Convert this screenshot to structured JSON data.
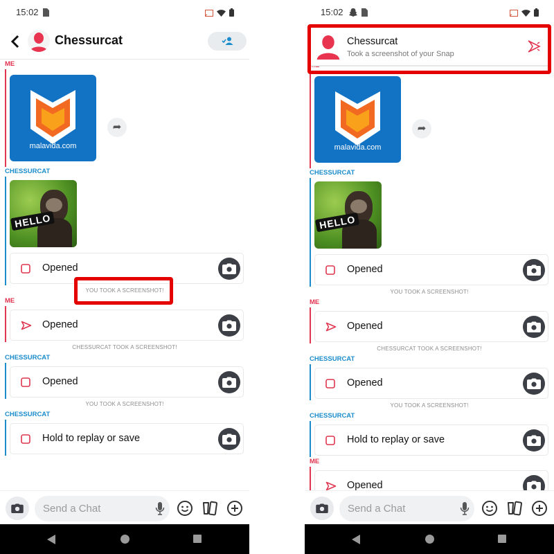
{
  "colors": {
    "me": "#e0344f",
    "them": "#1a8ccb",
    "highlight": "#e50000",
    "camera_button": "#3c3f45"
  },
  "status_bar": {
    "time": "15:02"
  },
  "left_panel": {
    "header": {
      "title": "Chessurcat",
      "back_icon": "chevron-left-icon",
      "add_friend_icon": "add-friend-icon"
    },
    "messages": [
      {
        "type": "label",
        "sender": "me",
        "text": "ME"
      },
      {
        "type": "group",
        "sender": "me",
        "first": true,
        "items": [
          {
            "kind": "image",
            "image": "malavida",
            "caption": "malavida.com"
          }
        ]
      },
      {
        "type": "label",
        "sender": "them",
        "text": "CHESSURCAT"
      },
      {
        "type": "group",
        "sender": "them",
        "items": [
          {
            "kind": "image",
            "image": "monkey",
            "caption": "HELLO"
          },
          {
            "kind": "snap",
            "icon": "square",
            "text": "Opened"
          }
        ]
      },
      {
        "type": "notice",
        "text": "YOU TOOK A SCREENSHOT!",
        "highlighted": true
      },
      {
        "type": "label",
        "sender": "me",
        "text": "ME"
      },
      {
        "type": "group",
        "sender": "me",
        "items": [
          {
            "kind": "snap",
            "icon": "arrow",
            "text": "Opened"
          }
        ]
      },
      {
        "type": "notice",
        "text": "CHESSURCAT TOOK A SCREENSHOT!"
      },
      {
        "type": "label",
        "sender": "them",
        "text": "CHESSURCAT"
      },
      {
        "type": "group",
        "sender": "them",
        "items": [
          {
            "kind": "snap",
            "icon": "square",
            "text": "Opened"
          }
        ]
      },
      {
        "type": "notice",
        "text": "YOU TOOK A SCREENSHOT!"
      },
      {
        "type": "label",
        "sender": "them",
        "text": "CHESSURCAT"
      },
      {
        "type": "group",
        "sender": "them",
        "items": [
          {
            "kind": "snap",
            "icon": "square",
            "text": "Hold to replay or save"
          }
        ]
      }
    ]
  },
  "right_panel": {
    "notification": {
      "title": "Chessurcat",
      "subtitle": "Took a screenshot of your Snap",
      "icon": "screenshot-arrow-icon",
      "highlighted": true
    },
    "messages": [
      {
        "type": "label",
        "sender": "me",
        "text": "ME"
      },
      {
        "type": "group",
        "sender": "me",
        "first": true,
        "items": [
          {
            "kind": "image",
            "image": "malavida",
            "caption": "malavida.com"
          }
        ]
      },
      {
        "type": "label",
        "sender": "them",
        "text": "CHESSURCAT"
      },
      {
        "type": "group",
        "sender": "them",
        "items": [
          {
            "kind": "image",
            "image": "monkey",
            "caption": "HELLO"
          },
          {
            "kind": "snap",
            "icon": "square",
            "text": "Opened"
          }
        ]
      },
      {
        "type": "notice",
        "text": "YOU TOOK A SCREENSHOT!"
      },
      {
        "type": "label",
        "sender": "me",
        "text": "ME"
      },
      {
        "type": "group",
        "sender": "me",
        "items": [
          {
            "kind": "snap",
            "icon": "arrow",
            "text": "Opened"
          }
        ]
      },
      {
        "type": "notice",
        "text": "CHESSURCAT TOOK A SCREENSHOT!"
      },
      {
        "type": "label",
        "sender": "them",
        "text": "CHESSURCAT"
      },
      {
        "type": "group",
        "sender": "them",
        "items": [
          {
            "kind": "snap",
            "icon": "square",
            "text": "Opened"
          }
        ]
      },
      {
        "type": "notice",
        "text": "YOU TOOK A SCREENSHOT!"
      },
      {
        "type": "label",
        "sender": "them",
        "text": "CHESSURCAT"
      },
      {
        "type": "group",
        "sender": "them",
        "items": [
          {
            "kind": "snap",
            "icon": "square",
            "text": "Hold to replay or save"
          }
        ]
      },
      {
        "type": "label",
        "sender": "me",
        "text": "ME"
      },
      {
        "type": "group",
        "sender": "me",
        "items": [
          {
            "kind": "snap",
            "icon": "arrow",
            "text": "Opened"
          }
        ]
      }
    ]
  },
  "composer": {
    "placeholder": "Send a Chat"
  }
}
